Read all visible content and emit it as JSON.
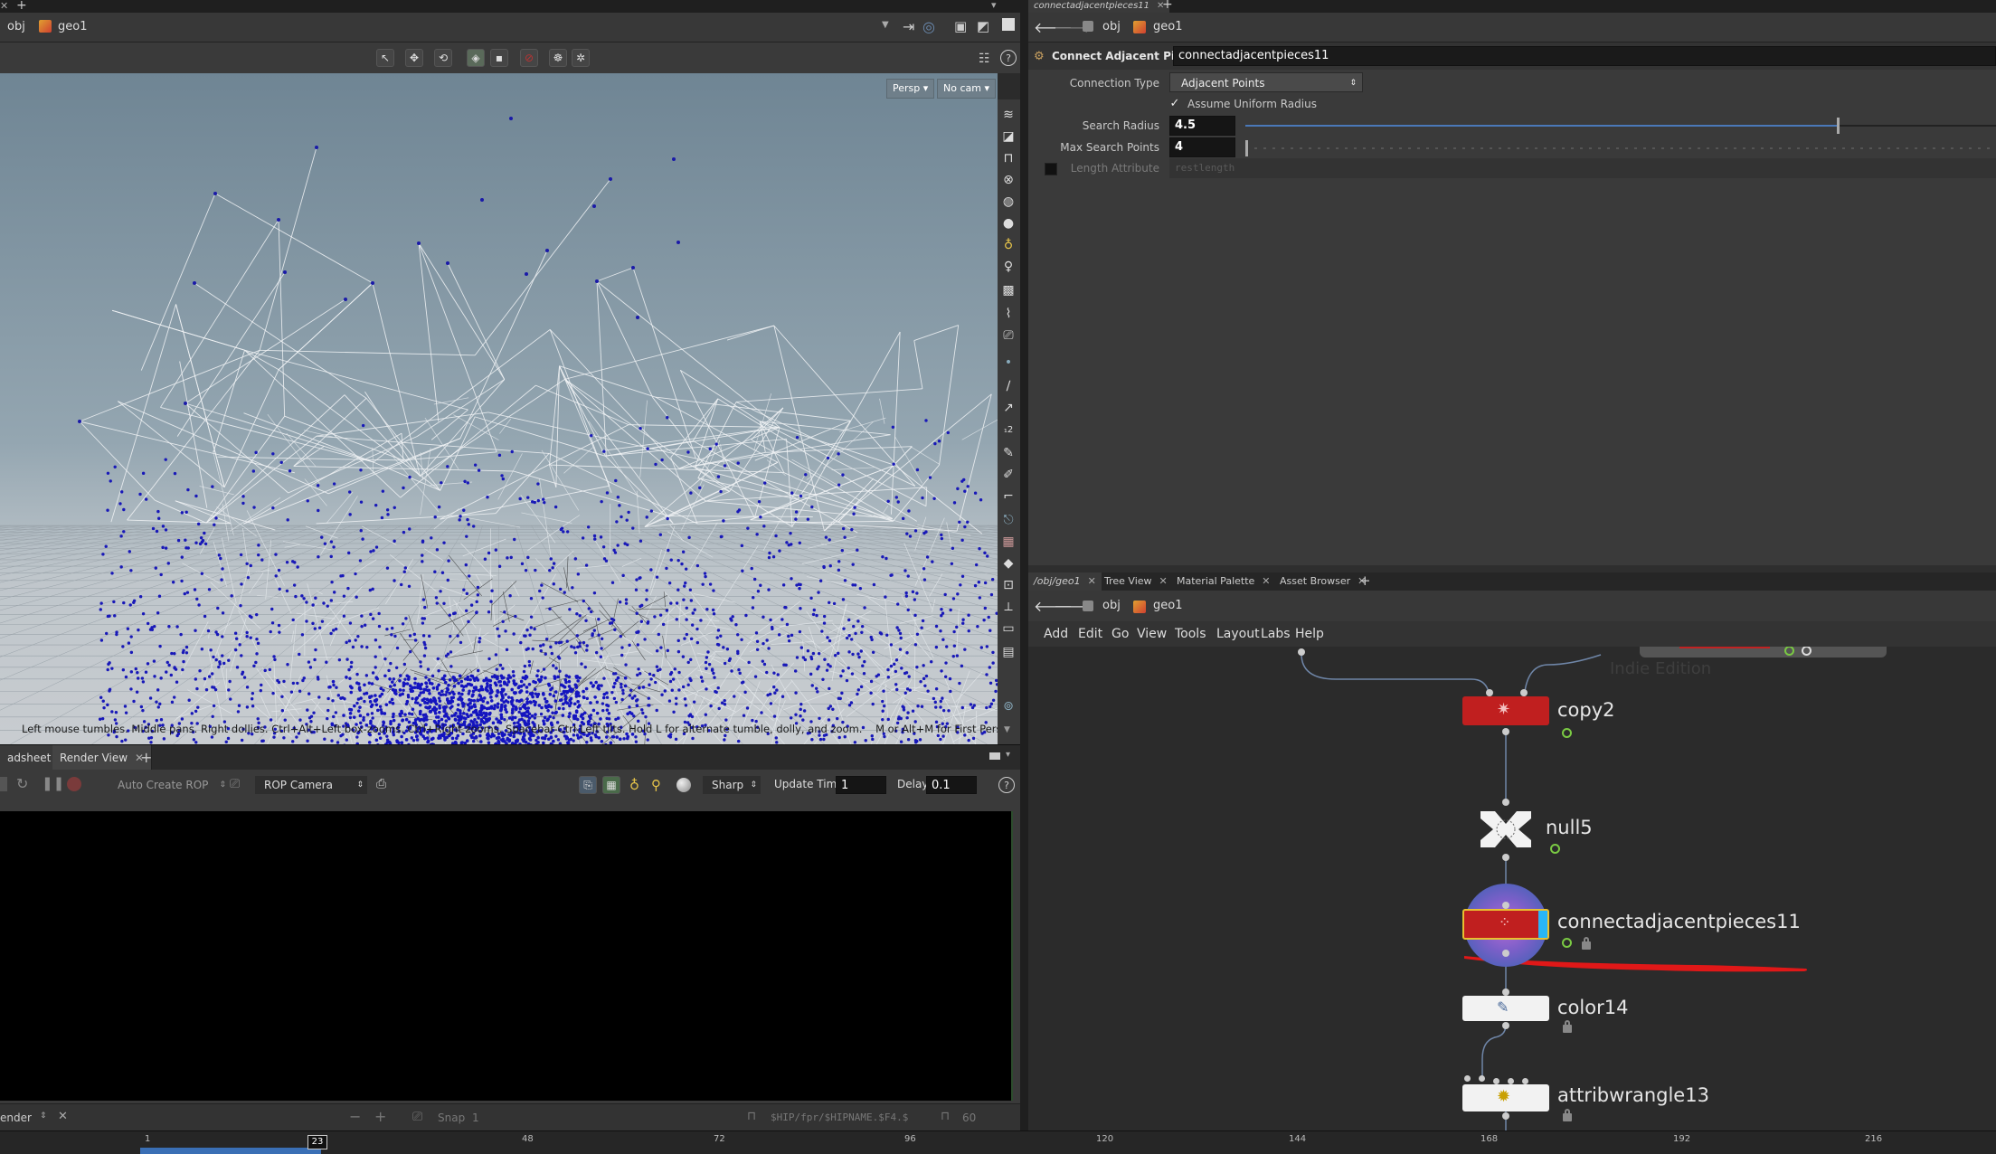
{
  "left_pane": {
    "path": {
      "root": "obj",
      "current": "geo1"
    },
    "viewport": {
      "persp_label": "Persp",
      "cam_label": "No cam",
      "status_message": "Left mouse tumbles. Middle pans. Right dollies. Ctrl+Alt+Left box-zooms. Ctrl+Right zooms. Spacebar-Ctrl-Left tilts. Hold L for alternate tumble, dolly, and zoom.    M or Alt+M for First Person Navigation."
    },
    "tabs": [
      {
        "label": "adsheet"
      },
      {
        "label": "Render View"
      }
    ],
    "render_toolbar": {
      "rop_label": "Auto Create ROP",
      "camera_label": "ROP Camera",
      "quality_label": "Sharp",
      "update_time_label": "Update Time",
      "update_time_value": "1",
      "delay_label": "Delay",
      "delay_value": "0.1"
    },
    "bottom_bar": {
      "render_label": "ender",
      "snap_label": "Snap",
      "snap_value": "1",
      "path_text": "$HIP/fpr/$HIPNAME.$F4.$",
      "zoom_value": "60"
    }
  },
  "params": {
    "tab_title": "connectadjacentpieces11",
    "path": {
      "root": "obj",
      "current": "geo1"
    },
    "node_type": "Connect Adjacent Pieces",
    "node_name": "connectadjacentpieces11",
    "connection_type_label": "Connection Type",
    "connection_type_value": "Adjacent Points",
    "assume_uniform_label": "Assume Uniform Radius",
    "assume_uniform_checked": true,
    "search_radius_label": "Search Radius",
    "search_radius_value": "4.5",
    "max_points_label": "Max Search Points",
    "max_points_value": "4",
    "length_attr_label": "Length Attribute",
    "length_attr_value": "restlength"
  },
  "network": {
    "tabs": [
      {
        "label": "/obj/geo1"
      },
      {
        "label": "Tree View"
      },
      {
        "label": "Material Palette"
      },
      {
        "label": "Asset Browser"
      }
    ],
    "path": {
      "root": "obj",
      "current": "geo1"
    },
    "menu": [
      "Add",
      "Edit",
      "Go",
      "View",
      "Tools",
      "Layout",
      "Labs",
      "Help"
    ],
    "watermark": "Indie Edition",
    "nodes": [
      {
        "name": "copy2"
      },
      {
        "name": "null5"
      },
      {
        "name": "connectadjacentpieces11"
      },
      {
        "name": "color14"
      },
      {
        "name": "attribwrangle13"
      }
    ]
  },
  "timeline": {
    "ticks": [
      "1",
      "48",
      "72",
      "96",
      "120",
      "144",
      "168",
      "192",
      "216"
    ],
    "current_frame": "23"
  }
}
